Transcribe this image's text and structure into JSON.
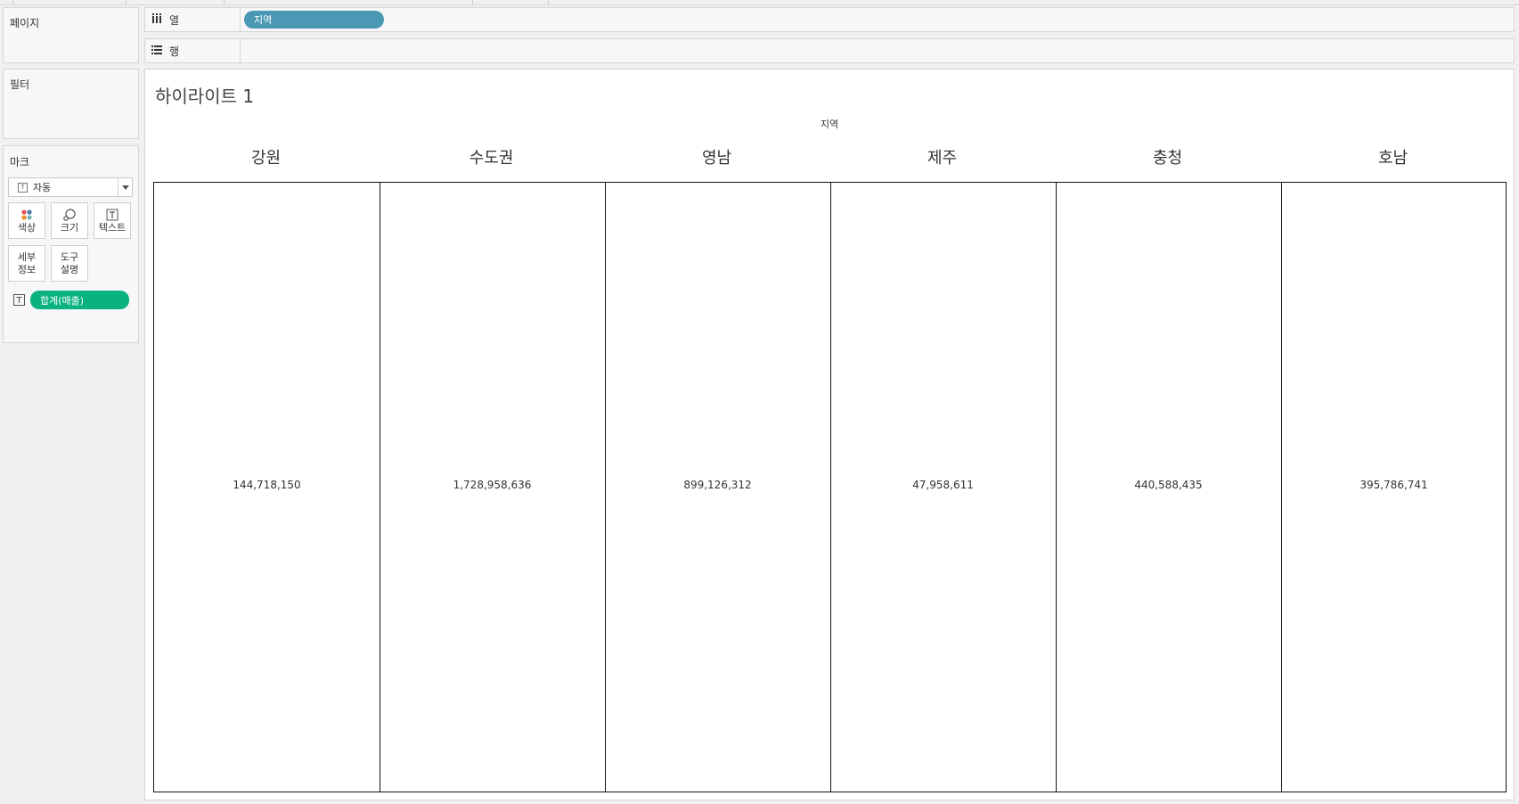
{
  "panels": {
    "pages_title": "페이지",
    "filters_title": "필터",
    "marks_title": "마크"
  },
  "marks": {
    "type_selected": "자동",
    "buttons": {
      "color": "색상",
      "size": "크기",
      "text": "텍스트",
      "detail_1": "세부",
      "detail_2": "정보",
      "tooltip_1": "도구",
      "tooltip_2": "설명"
    },
    "field_pill": "합계(매출)",
    "field_pill_color": "#0ab27f"
  },
  "shelves": {
    "columns_label": "열",
    "columns_pill": "지역",
    "columns_pill_color": "#4a98b4",
    "rows_label": "행"
  },
  "view": {
    "title": "하이라이트 1",
    "axis_title": "지역",
    "regions": [
      {
        "name": "강원",
        "value": "144,718,150"
      },
      {
        "name": "수도권",
        "value": "1,728,958,636"
      },
      {
        "name": "영남",
        "value": "899,126,312"
      },
      {
        "name": "제주",
        "value": "47,958,611"
      },
      {
        "name": "충청",
        "value": "440,588,435"
      },
      {
        "name": "호남",
        "value": "395,786,741"
      }
    ]
  }
}
